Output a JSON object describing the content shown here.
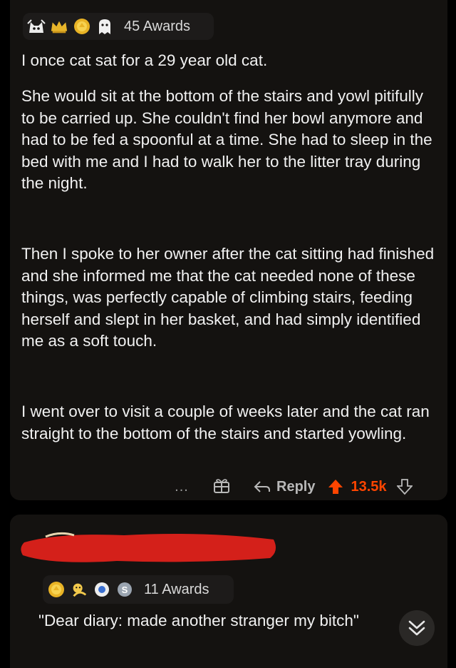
{
  "parent_comment": {
    "awards": {
      "icons": [
        "cat-award-icon",
        "crown-award-icon",
        "gold-award-icon",
        "ghost-award-icon"
      ],
      "label": "45 Awards"
    },
    "paragraphs": [
      "I once cat sat for a 29 year old cat.",
      "She would sit at the bottom of the stairs and yowl pitifully to be carried up. She couldn't find her bowl anymore and had to be fed a spoonful at a time. She had to sleep in the bed with me and I had to walk her to the litter tray during the night.",
      "Then I spoke to her owner after the cat sitting had finished and she informed me that the cat needed none of these things, was perfectly capable of climbing stairs, feeding herself and slept in her basket, and had simply identified me as a soft touch.",
      "I went over to visit a couple of weeks later and the cat ran straight to the bottom of the stairs and started yowling."
    ],
    "actions": {
      "more": "...",
      "gift_icon": "gift-icon",
      "reply_label": "Reply",
      "score": "13.5k"
    }
  },
  "reply_comment": {
    "awards": {
      "icons": [
        "gold-award-icon",
        "wholesome-award-icon",
        "helpful-award-icon",
        "silver-award-icon"
      ],
      "label": "11 Awards"
    },
    "text": "\"Dear diary: made another stranger my bitch\""
  },
  "colors": {
    "background": "#000000",
    "card": "#141210",
    "upvote": "#ff4500",
    "redaction": "#d4201a"
  }
}
